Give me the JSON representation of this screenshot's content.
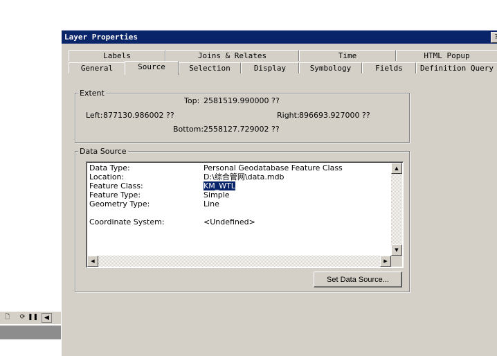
{
  "dialog": {
    "title": "Layer Properties",
    "help_label": "?"
  },
  "tabs_back": [
    "Labels",
    "Joins & Relates",
    "Time",
    "HTML Popup"
  ],
  "tabs_front": [
    "General",
    "Source",
    "Selection",
    "Display",
    "Symbology",
    "Fields",
    "Definition Query"
  ],
  "active_tab": "Source",
  "extent": {
    "group_label": "Extent",
    "top_label": "Top:",
    "top_value": "2581519.990000 ??",
    "left_label": "Left:",
    "left_value": "877130.986002 ??",
    "right_label": "Right:",
    "right_value": "896693.927000 ??",
    "bottom_label": "Bottom:",
    "bottom_value": "2558127.729002 ??"
  },
  "data_source": {
    "group_label": "Data Source",
    "rows": [
      {
        "label": "Data Type:",
        "value": "Personal Geodatabase Feature Class"
      },
      {
        "label": "Location:",
        "value": "D:\\综合管网\\data.mdb"
      },
      {
        "label": "Feature Class:",
        "value": "KM_WTL"
      },
      {
        "label": "Feature Type:",
        "value": "Simple"
      },
      {
        "label": "Geometry Type:",
        "value": "Line"
      },
      {
        "label": "Coordinate System:",
        "value": "<Undefined>"
      }
    ],
    "set_button_label": "Set Data Source..."
  },
  "background_toolbar": {
    "icons": [
      "page-icon",
      "refresh-icon",
      "pause-icon",
      "scroll-left-icon"
    ]
  }
}
